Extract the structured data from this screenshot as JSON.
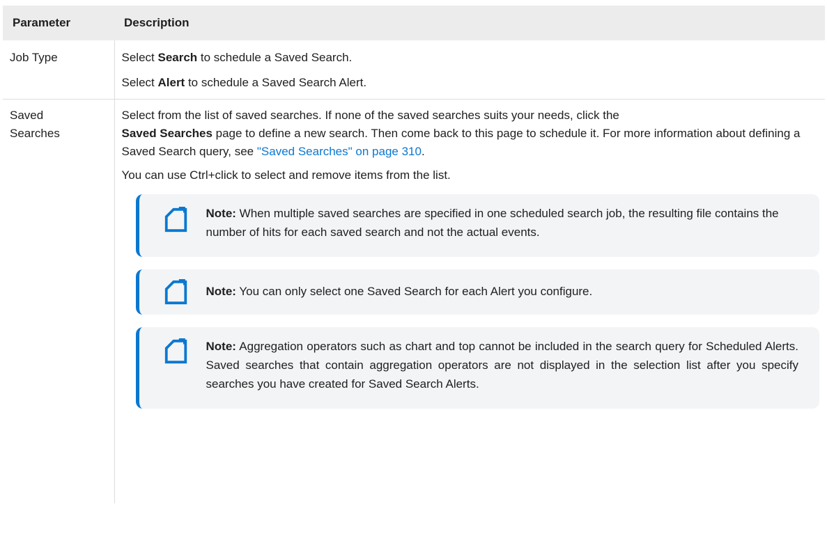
{
  "table": {
    "headers": {
      "parameter": "Parameter",
      "description": "Description"
    },
    "rows": [
      {
        "parameter": "Job Type",
        "lines": [
          {
            "pre": "Select ",
            "bold": "Search",
            "post": " to schedule a Saved Search."
          },
          {
            "pre": "Select ",
            "bold": "Alert",
            "post": " to schedule a Saved Search Alert."
          }
        ]
      },
      {
        "parameter_line1": "Saved",
        "parameter_line2": "Searches",
        "desc1_a": "Select from the list of saved searches. If none of the saved searches suits your needs, click the",
        "desc1_bold": "Saved Searches",
        "desc1_b": " page to define a new search. Then come back to this page to schedule it. For more information about defining a Saved Search query, see ",
        "desc1_link": "\"Saved Searches\" on page 310",
        "desc1_end": ".",
        "desc2": "You can use Ctrl+click to select and remove items from the list.",
        "notes": [
          {
            "label": "Note:",
            "text": " When multiple saved searches are specified in one scheduled search job, the resulting file contains the number of hits for each saved search and not the actual events."
          },
          {
            "label": "Note:",
            "text": " You can only select one Saved Search for each Alert you configure."
          },
          {
            "label": "Note:",
            "text": " Aggregation operators such as chart and top cannot be included in the search query for Scheduled Alerts. Saved searches that contain aggregation operators are not displayed in the selection list after you specify searches you have created for Saved Search Alerts."
          }
        ]
      }
    ]
  },
  "icons": {
    "note": "note-icon"
  },
  "colors": {
    "accent": "#0b78d0",
    "header_bg": "#ececec",
    "note_bg": "#f3f4f6"
  }
}
